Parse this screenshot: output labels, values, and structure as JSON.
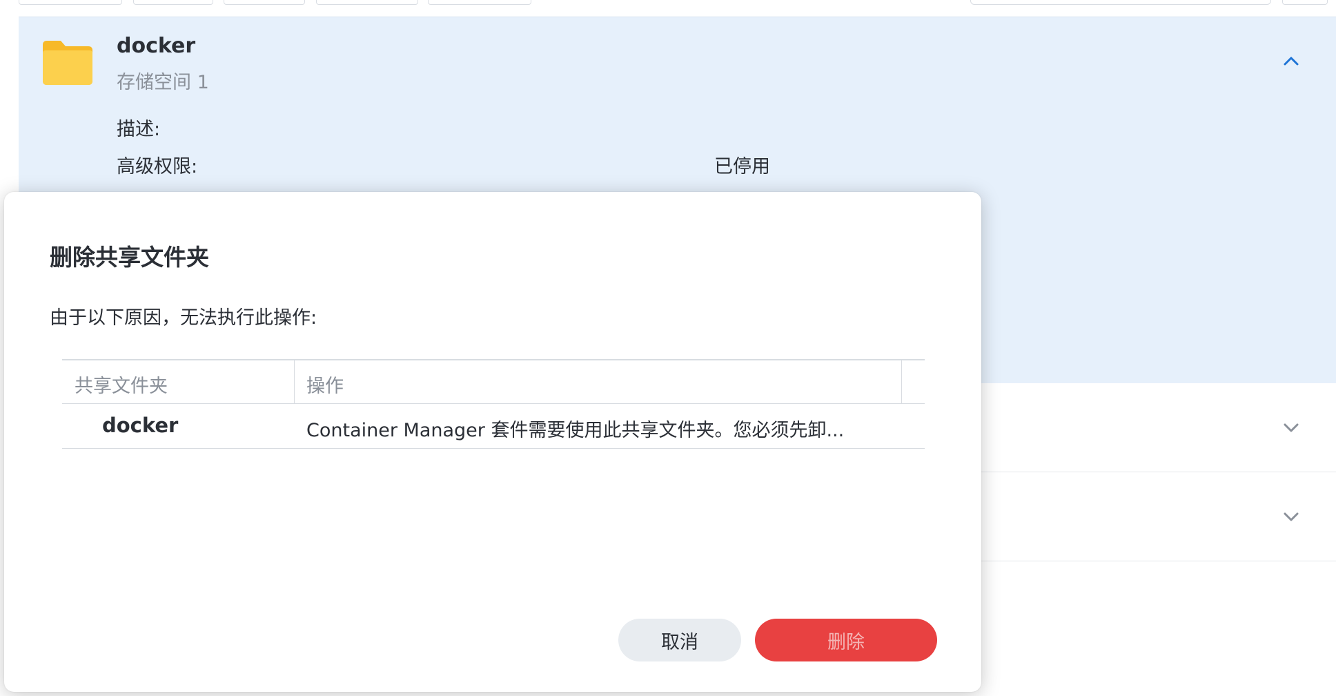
{
  "folder": {
    "name": "docker",
    "volume": "存储空间 1",
    "details": [
      {
        "label": "描述:",
        "value": ""
      },
      {
        "label": "高级权限:",
        "value": "已停用"
      }
    ]
  },
  "dialog": {
    "title": "删除共享文件夹",
    "message": "由于以下原因，无法执行此操作:",
    "table": {
      "columns": [
        "共享文件夹",
        "操作"
      ],
      "rows": [
        {
          "shared_folder": "docker",
          "action": "Container Manager 套件需要使用此共享文件夹。您必须先卸..."
        }
      ]
    },
    "cancel_label": "取消",
    "delete_label": "删除"
  },
  "colors": {
    "panel_bg": "#e6f0fb",
    "accent_blue": "#1e74d6",
    "folder_yellow": "#f9c530",
    "delete_red": "#e84141"
  },
  "icons": {
    "folder": "folder-icon",
    "expanded": "chevron-up-icon",
    "collapsed": "chevron-down-icon"
  }
}
